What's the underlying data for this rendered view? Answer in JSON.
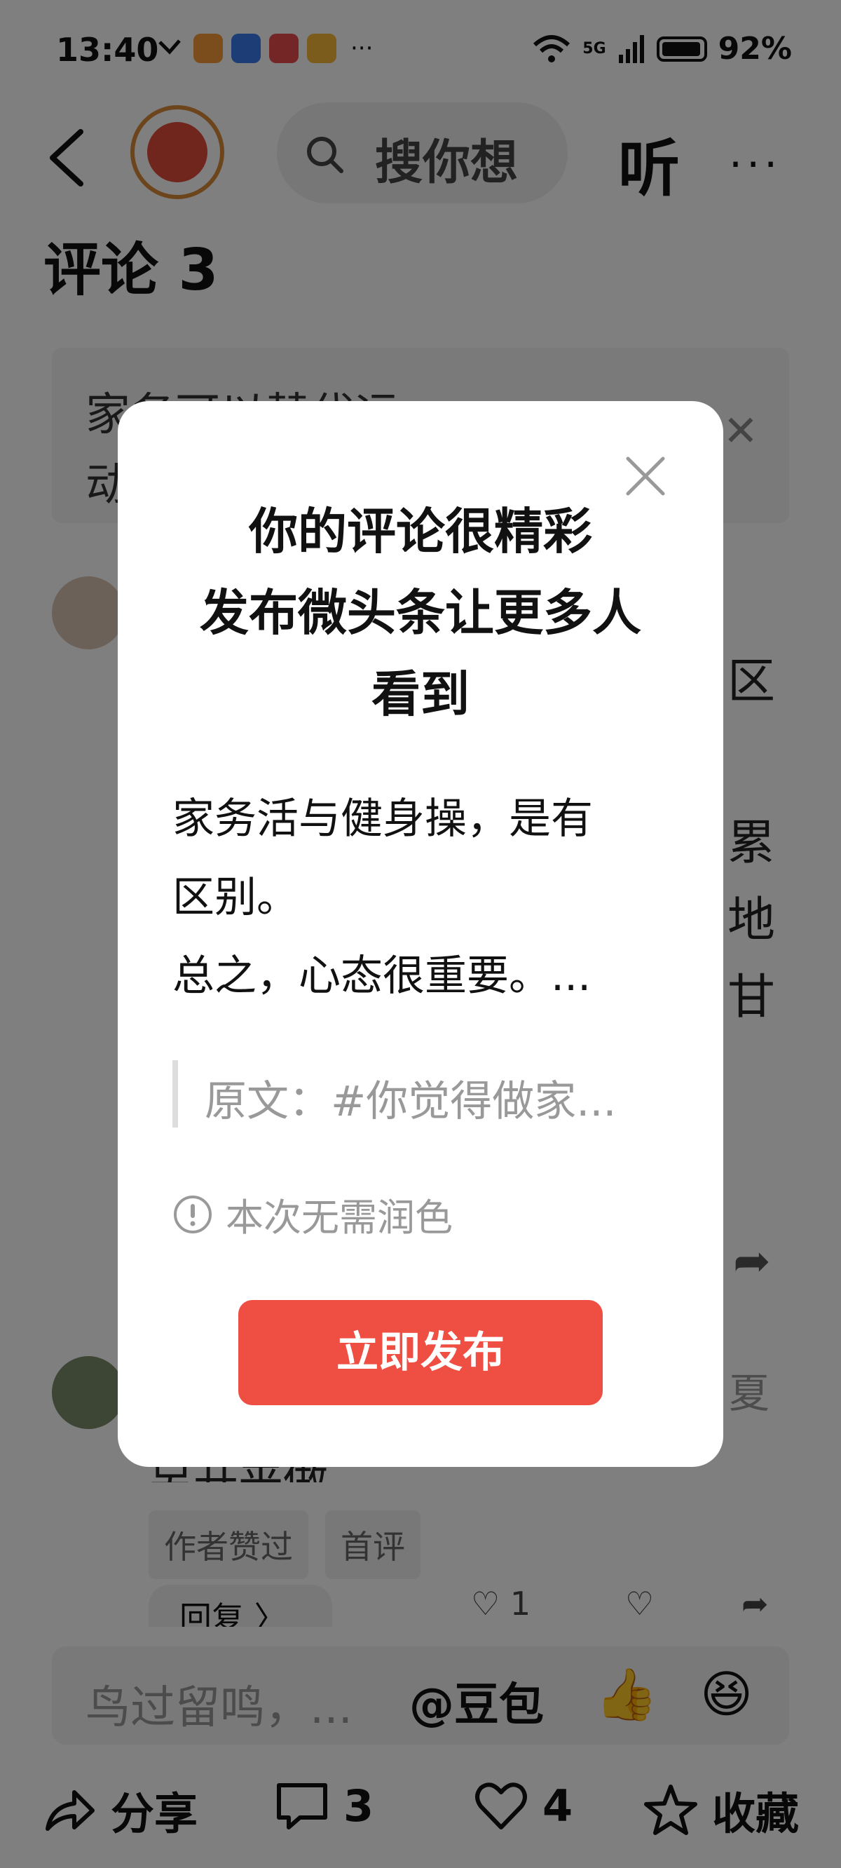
{
  "status_bar": {
    "time": "13:40",
    "network": "5G",
    "battery": "92%",
    "more": "···"
  },
  "nav": {
    "search_placeholder": "搜你想",
    "listen_label": "听",
    "more_label": "···"
  },
  "comments": {
    "title": "评论 3",
    "topic_line1": "家务可以替代运",
    "topic_line2": "动",
    "c1_side_fragments": [
      "区",
      "累",
      "地",
      "甘"
    ],
    "c2_side_fragment": "夏",
    "c2_partial": "另开来做",
    "tags": [
      "作者赞过",
      "首评"
    ],
    "reply_label": "回复 〉",
    "reply_like_count": "1"
  },
  "input_bar": {
    "placeholder": "鸟过留鸣，...",
    "doubao_label": "@豆包"
  },
  "bottom_bar": {
    "share_label": "分享",
    "comment_count": "3",
    "like_count": "4",
    "favorite_label": "收藏"
  },
  "modal": {
    "title_lines": [
      "你的评论很精彩",
      "发布微头条让更多人",
      "看到"
    ],
    "comment_lines": [
      "家务活与健身操，是有",
      "区别。",
      "总之，心态很重要。..."
    ],
    "quote_text": "原文：#你觉得做家...",
    "note_text": "本次无需润色",
    "publish_button": "立即发布"
  },
  "colors": {
    "publish_button": "#ef4e43",
    "overlay": "rgba(0,0,0,0.5)",
    "app_logo": "#e04a3a",
    "app_logo_ring": "#d98a3a"
  }
}
